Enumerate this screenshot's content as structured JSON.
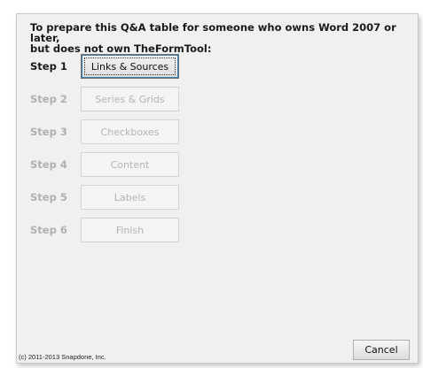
{
  "dialog": {
    "instruction": "To prepare this Q&A table for someone who owns Word 2007 or later,\nbut does not own TheFormTool:",
    "steps": [
      {
        "label": "Step 1",
        "button": "Links & Sources",
        "enabled": true
      },
      {
        "label": "Step 2",
        "button": "Series & Grids",
        "enabled": false
      },
      {
        "label": "Step 3",
        "button": "Checkboxes",
        "enabled": false
      },
      {
        "label": "Step 4",
        "button": "Content",
        "enabled": false
      },
      {
        "label": "Step 5",
        "button": "Labels",
        "enabled": false
      },
      {
        "label": "Step 6",
        "button": "Finish",
        "enabled": false
      }
    ],
    "copyright": "(c) 2011-2013 Snapdone, Inc.",
    "cancel_label": "Cancel"
  },
  "colors": {
    "dialog_bg": "#f0f0f0",
    "disabled_text": "#b0b0b0",
    "focus_accent": "#3c7fb1"
  }
}
